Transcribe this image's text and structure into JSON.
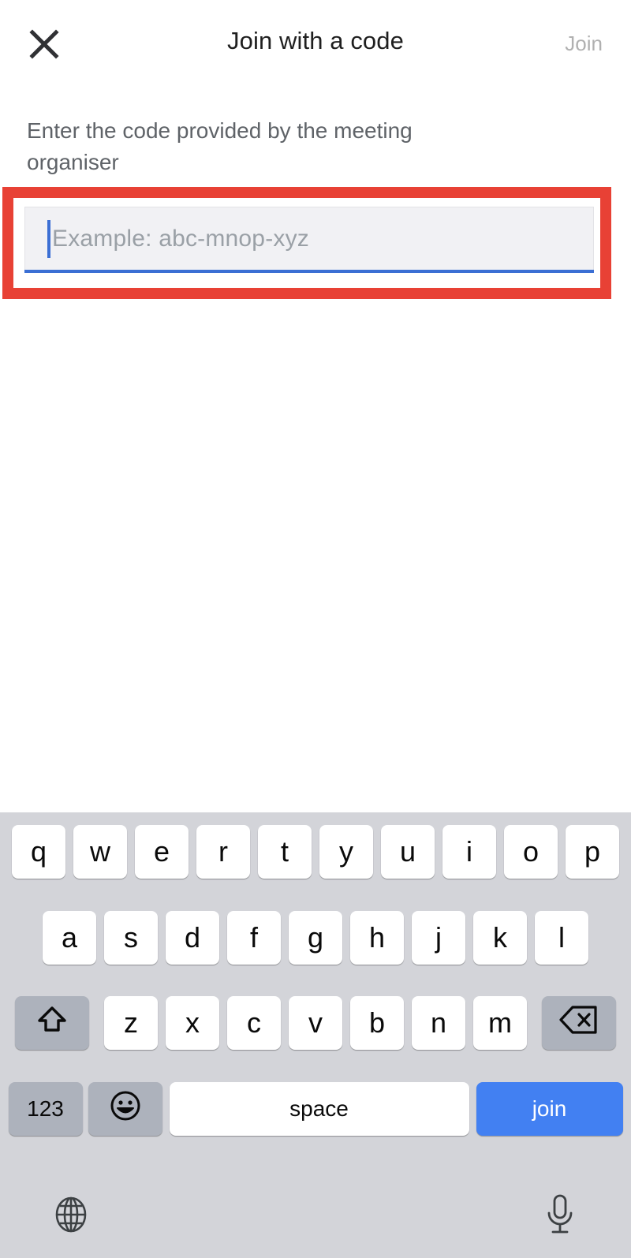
{
  "header": {
    "close_icon": "close-icon",
    "title": "Join with a code",
    "action_label": "Join",
    "action_color": "#b0b0b0"
  },
  "form": {
    "description": "Enter the code provided by the meeting organiser",
    "code_input": {
      "value": "",
      "placeholder": "Example: abc-mnop-xyz",
      "caret_color": "#3b6fd4",
      "underline_color": "#3b6fd4",
      "background": "#f1f1f4"
    },
    "highlight": {
      "color": "#e84135",
      "target": "code-input"
    }
  },
  "keyboard": {
    "background": "#d3d4d9",
    "rows": [
      {
        "keys": [
          {
            "label": "q",
            "name": "key-q"
          },
          {
            "label": "w",
            "name": "key-w"
          },
          {
            "label": "e",
            "name": "key-e"
          },
          {
            "label": "r",
            "name": "key-r"
          },
          {
            "label": "t",
            "name": "key-t"
          },
          {
            "label": "y",
            "name": "key-y"
          },
          {
            "label": "u",
            "name": "key-u"
          },
          {
            "label": "i",
            "name": "key-i"
          },
          {
            "label": "o",
            "name": "key-o"
          },
          {
            "label": "p",
            "name": "key-p"
          }
        ]
      },
      {
        "keys": [
          {
            "label": "a",
            "name": "key-a"
          },
          {
            "label": "s",
            "name": "key-s"
          },
          {
            "label": "d",
            "name": "key-d"
          },
          {
            "label": "f",
            "name": "key-f"
          },
          {
            "label": "g",
            "name": "key-g"
          },
          {
            "label": "h",
            "name": "key-h"
          },
          {
            "label": "j",
            "name": "key-j"
          },
          {
            "label": "k",
            "name": "key-k"
          },
          {
            "label": "l",
            "name": "key-l"
          }
        ]
      },
      {
        "keys": [
          {
            "label": "",
            "name": "shift-key",
            "icon": "shift-arrow-icon"
          },
          {
            "label": "z",
            "name": "key-z"
          },
          {
            "label": "x",
            "name": "key-x"
          },
          {
            "label": "c",
            "name": "key-c"
          },
          {
            "label": "v",
            "name": "key-v"
          },
          {
            "label": "b",
            "name": "key-b"
          },
          {
            "label": "n",
            "name": "key-n"
          },
          {
            "label": "m",
            "name": "key-m"
          },
          {
            "label": "",
            "name": "backspace-key",
            "icon": "backspace-icon"
          }
        ]
      },
      {
        "keys": [
          {
            "label": "123",
            "name": "numeric-key"
          },
          {
            "label": "",
            "name": "emoji-key",
            "icon": "smiley-icon"
          },
          {
            "label": "space",
            "name": "space-key"
          },
          {
            "label": "join",
            "name": "join-key",
            "color": "#4280f2"
          }
        ]
      }
    ],
    "bottom_bar": {
      "globe_icon": "globe-icon",
      "mic_icon": "microphone-icon"
    }
  }
}
